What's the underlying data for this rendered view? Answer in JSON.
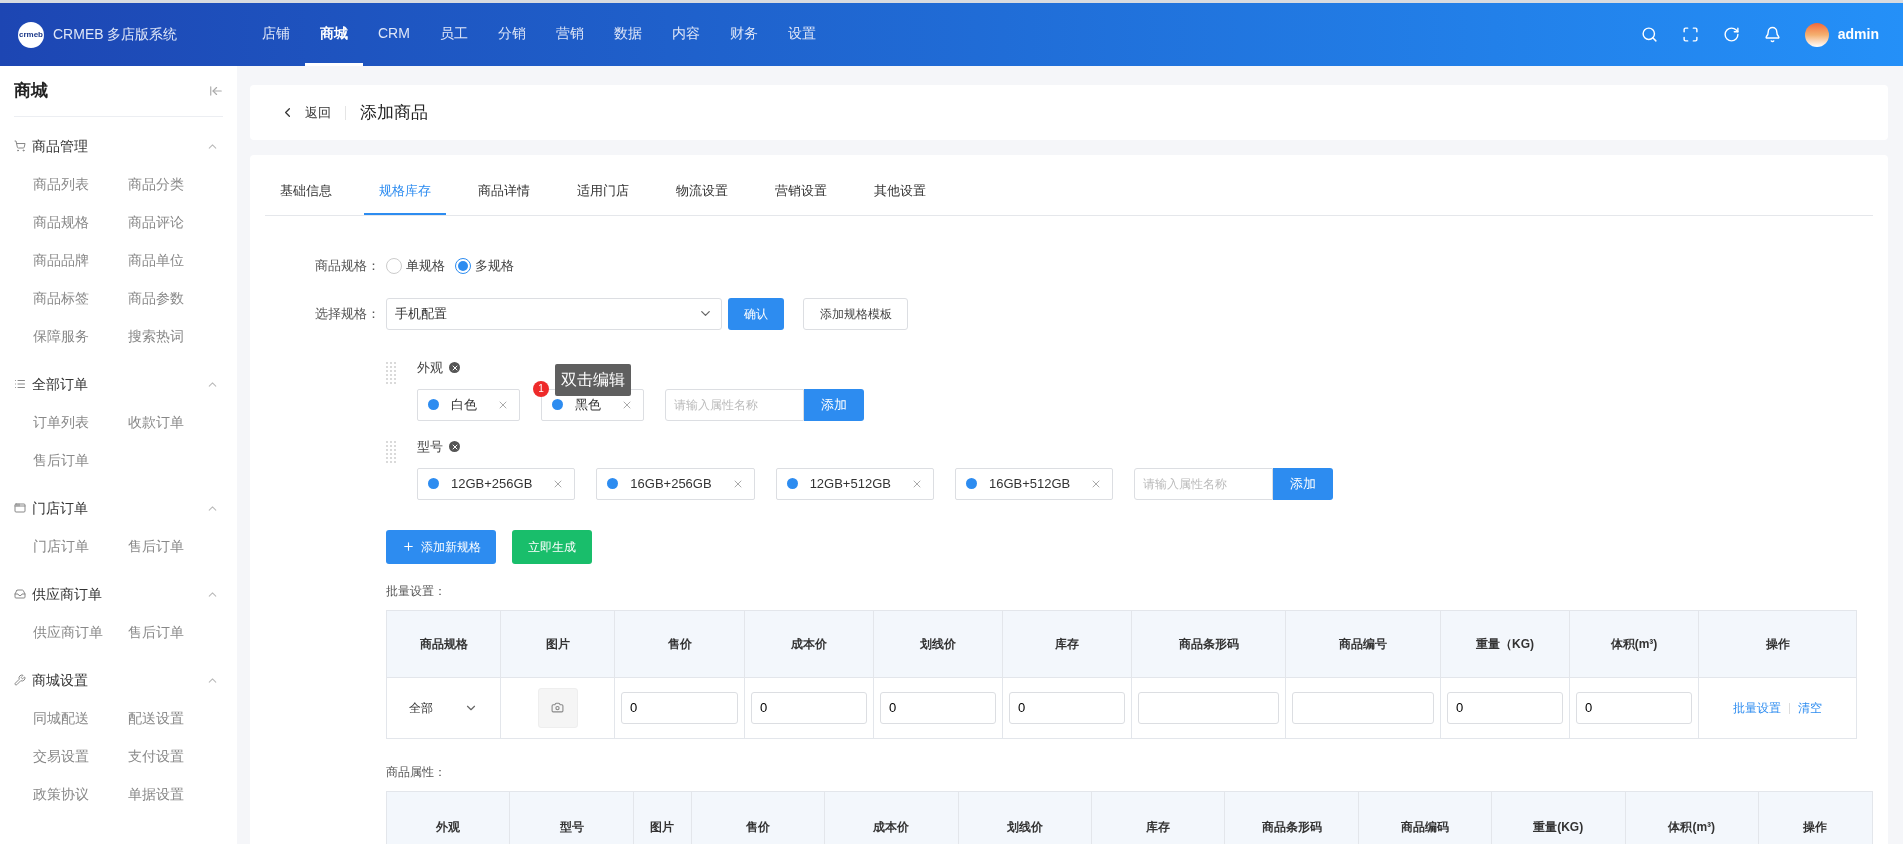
{
  "header": {
    "logo": "crmeb",
    "brand": "CRMEB 多店版系统",
    "user": "admin",
    "nav": [
      {
        "label": "店铺",
        "selected": false
      },
      {
        "label": "商城",
        "selected": true
      },
      {
        "label": "CRM",
        "selected": false
      },
      {
        "label": "员工",
        "selected": false
      },
      {
        "label": "分销",
        "selected": false
      },
      {
        "label": "营销",
        "selected": false
      },
      {
        "label": "数据",
        "selected": false
      },
      {
        "label": "内容",
        "selected": false
      },
      {
        "label": "财务",
        "selected": false
      },
      {
        "label": "设置",
        "selected": false
      }
    ]
  },
  "sidebar": {
    "title": "商城",
    "groups": [
      {
        "title": "商品管理",
        "kind": "cart",
        "expanded": true,
        "items": [
          "商品列表",
          "商品分类",
          "商品规格",
          "商品评论",
          "商品品牌",
          "商品单位",
          "商品标签",
          "商品参数",
          "保障服务",
          "搜索热词"
        ]
      },
      {
        "title": "全部订单",
        "kind": "list",
        "expanded": true,
        "items": [
          "订单列表",
          "收款订单",
          "售后订单"
        ]
      },
      {
        "title": "门店订单",
        "kind": "window",
        "expanded": true,
        "items": [
          "门店订单",
          "售后订单"
        ]
      },
      {
        "title": "供应商订单",
        "kind": "inbox",
        "expanded": true,
        "items": [
          "供应商订单",
          "售后订单"
        ]
      },
      {
        "title": "商城设置",
        "kind": "wrench",
        "expanded": true,
        "items": [
          "同城配送",
          "配送设置",
          "交易设置",
          "支付设置",
          "政策协议",
          "单据设置"
        ]
      }
    ]
  },
  "page_header": {
    "back": "返回",
    "title": "添加商品"
  },
  "tabs": [
    {
      "label": "基础信息",
      "selected": false
    },
    {
      "label": "规格库存",
      "selected": true
    },
    {
      "label": "商品详情",
      "selected": false
    },
    {
      "label": "适用门店",
      "selected": false
    },
    {
      "label": "物流设置",
      "selected": false
    },
    {
      "label": "营销设置",
      "selected": false
    },
    {
      "label": "其他设置",
      "selected": false
    }
  ],
  "form": {
    "spec_type": {
      "label": "商品规格：",
      "options": [
        {
          "label": "单规格",
          "selected": false
        },
        {
          "label": "多规格",
          "selected": true
        }
      ]
    },
    "select_spec": {
      "label": "选择规格：",
      "value": "手机配置",
      "confirm": "确认",
      "template": "添加规格模板"
    },
    "specs": [
      {
        "name": "外观",
        "values": [
          {
            "label": "白色"
          },
          {
            "label": "黑色",
            "tooltip": {
              "badge": "1",
              "text": "双击编辑"
            }
          }
        ],
        "placeholder": "请输入属性名称",
        "add": "添加"
      },
      {
        "name": "型号",
        "values": [
          {
            "label": "12GB+256GB"
          },
          {
            "label": "16GB+256GB"
          },
          {
            "label": "12GB+512GB"
          },
          {
            "label": "16GB+512GB"
          }
        ],
        "placeholder": "请输入属性名称",
        "add": "添加"
      }
    ],
    "add_spec": "添加新规格",
    "generate": "立即生成"
  },
  "batch": {
    "title": "批量设置：",
    "columns": [
      {
        "label": "商品规格",
        "kind": "select",
        "value": "全部"
      },
      {
        "label": "图片",
        "kind": "image"
      },
      {
        "label": "售价",
        "kind": "input",
        "value": "0"
      },
      {
        "label": "成本价",
        "kind": "input",
        "value": "0"
      },
      {
        "label": "划线价",
        "kind": "input",
        "value": "0"
      },
      {
        "label": "库存",
        "kind": "input",
        "value": "0"
      },
      {
        "label": "商品条形码",
        "kind": "input"
      },
      {
        "label": "商品编号",
        "kind": "input"
      },
      {
        "label": "重量（KG)",
        "kind": "input",
        "value": "0"
      },
      {
        "label": "体积(m³)",
        "kind": "input",
        "value": "0"
      },
      {
        "label": "操作",
        "kind": "actions",
        "actions": [
          "批量设置",
          "清空"
        ]
      }
    ]
  },
  "attrs": {
    "title": "商品属性：",
    "columns": [
      "外观",
      "型号",
      "图片",
      "售价",
      "成本价",
      "划线价",
      "库存",
      "商品条形码",
      "商品编码",
      "重量(KG)",
      "体积(m³)",
      "操作"
    ]
  }
}
